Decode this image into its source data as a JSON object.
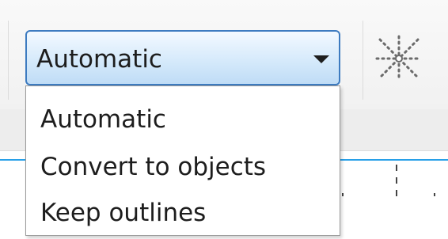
{
  "combo": {
    "value": "Automatic",
    "arrow_icon": "triangle-down-icon"
  },
  "dropdown": {
    "items": [
      {
        "label": "Automatic",
        "selected": true
      },
      {
        "label": "Convert to objects",
        "selected": false
      },
      {
        "label": "Keep outlines",
        "selected": false
      }
    ]
  },
  "toolbar": {
    "tool_icon": "dotted-sparkle-icon"
  },
  "colors": {
    "combo_border": "#3d7bc0",
    "combo_fill": "#d6eafb",
    "guide": "#28a0e8"
  }
}
